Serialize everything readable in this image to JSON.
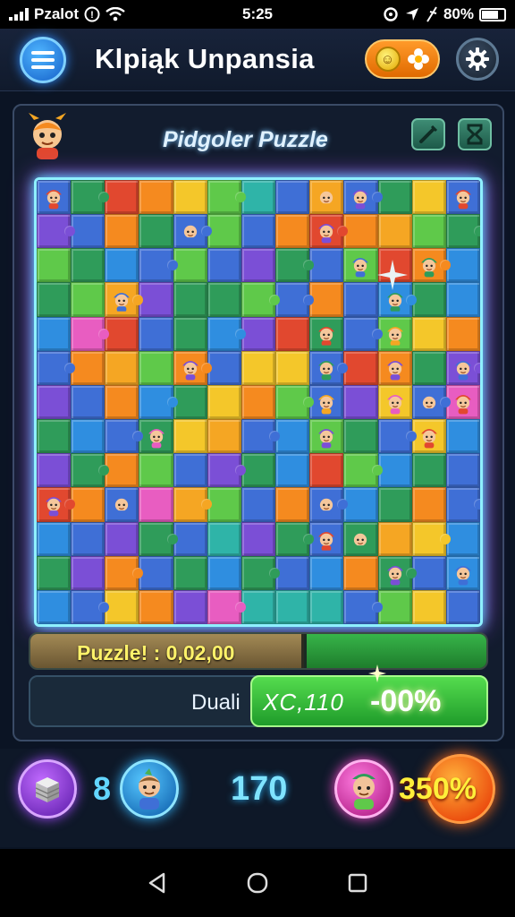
{
  "status_bar": {
    "carrier": "Pzalot",
    "time": "5:25",
    "battery": "80%"
  },
  "header": {
    "title": "Klpiąk Unpansia",
    "menu_icon": "hamburger-menu-icon",
    "coin_icon": "coin-smiley-icon",
    "flower_icon": "flower-icon",
    "settings_icon": "gear-icon"
  },
  "panel": {
    "title": "Pidgoler Puzzle",
    "tools": [
      {
        "icon": "wand-icon"
      },
      {
        "icon": "hourglass-icon"
      }
    ]
  },
  "board": {
    "rows": 13,
    "cols": 13,
    "palette": [
      "#e1482f",
      "#f58a1f",
      "#f4c72a",
      "#5fc94a",
      "#2f9c5a",
      "#3f6fd6",
      "#2f8ee0",
      "#7b4fd6",
      "#e85dc1",
      "#2fb4a8",
      "#f5a623",
      "#4aa3ff"
    ],
    "tiles": [
      "F7R1",
      "E1",
      "A1",
      "B1",
      "C1",
      "D1",
      "J1",
      "F1",
      "K1",
      "F1",
      "E1",
      "C1",
      "F1",
      "H1",
      "F1",
      "B1",
      "E1",
      "F1",
      "D1",
      "F1",
      "B1",
      "A1",
      "B1",
      "K1",
      "D1",
      "E1",
      "D1",
      "E1",
      "G1",
      "F3K",
      "D1",
      "F1",
      "H1",
      "E1",
      "F1",
      "D1",
      "A1",
      "B1",
      "G1",
      "E1",
      "D1",
      "K1",
      "H1",
      "E1",
      "E1",
      "D1",
      "F3K",
      "B1",
      "F1",
      "G1",
      "E1",
      "G1",
      "G1",
      "I1",
      "A1",
      "F1",
      "E1",
      "G1",
      "H1",
      "A1",
      "E1",
      "F1",
      "D1",
      "C1",
      "B1",
      "F1",
      "B1",
      "K1",
      "D1",
      "B1",
      "F1",
      "C1",
      "C1",
      "F1",
      "A1",
      "B1",
      "E1",
      "H1",
      "H1",
      "F1",
      "B1",
      "G1",
      "E1",
      "C1",
      "B1",
      "D1",
      "F1",
      "H1",
      "C1",
      "F1",
      "I1",
      "E1",
      "G1",
      "F1",
      "E1",
      "C1",
      "K1",
      "F1",
      "G1",
      "D1",
      "E1",
      "F1",
      "C1",
      "G1",
      "H1",
      "E1",
      "B1",
      "D1",
      "F1",
      "H1",
      "E1",
      "G1",
      "A1",
      "D1",
      "G1",
      "E1",
      "F1",
      "A1",
      "B1",
      "F1",
      "I1",
      "K1",
      "D1",
      "F1",
      "B1",
      "F1",
      "G1",
      "E1",
      "B1",
      "F1",
      "G1",
      "F1",
      "H1",
      "E1",
      "F1",
      "J1",
      "H1",
      "E1",
      "F1",
      "E1",
      "K1",
      "C1",
      "G1",
      "E1",
      "H1",
      "B1",
      "F1",
      "E1",
      "G1",
      "E1",
      "F1",
      "G1",
      "B1",
      "E1",
      "F1",
      "G1",
      "G1",
      "F1",
      "C1",
      "B1",
      "H1",
      "I1",
      "J1",
      "J1",
      "J1",
      "F1",
      "D1",
      "C1",
      "F1"
    ],
    "faces": [
      [
        0,
        0
      ],
      [
        0,
        8
      ],
      [
        0,
        9
      ],
      [
        0,
        12
      ],
      [
        1,
        4
      ],
      [
        1,
        8
      ],
      [
        2,
        9
      ],
      [
        2,
        11
      ],
      [
        3,
        2
      ],
      [
        3,
        10
      ],
      [
        4,
        8
      ],
      [
        4,
        10
      ],
      [
        5,
        4
      ],
      [
        5,
        8
      ],
      [
        5,
        10
      ],
      [
        5,
        12
      ],
      [
        6,
        8
      ],
      [
        6,
        10
      ],
      [
        6,
        11
      ],
      [
        6,
        12
      ],
      [
        7,
        3
      ],
      [
        7,
        8
      ],
      [
        7,
        11
      ],
      [
        9,
        0
      ],
      [
        9,
        2
      ],
      [
        9,
        8
      ],
      [
        10,
        8
      ],
      [
        10,
        9
      ],
      [
        11,
        10
      ],
      [
        11,
        12
      ]
    ]
  },
  "progress": {
    "label": "Puzzle! : 0,02,00",
    "fraction": 0.6
  },
  "stats": {
    "dual_label": "Duali",
    "multiplier": "XC,110",
    "percent": "-00%"
  },
  "bottom_bar": {
    "left_icon": "storage-stack-icon",
    "left_count": "8",
    "avatar_icon": "elf-avatar-icon",
    "center_count": "170",
    "right_avatar_icon": "elf-hat-avatar-icon",
    "right_percent": "350%"
  },
  "nav": {
    "back_icon": "back-triangle-icon",
    "home_icon": "home-circle-icon",
    "recents_icon": "recents-square-icon"
  }
}
